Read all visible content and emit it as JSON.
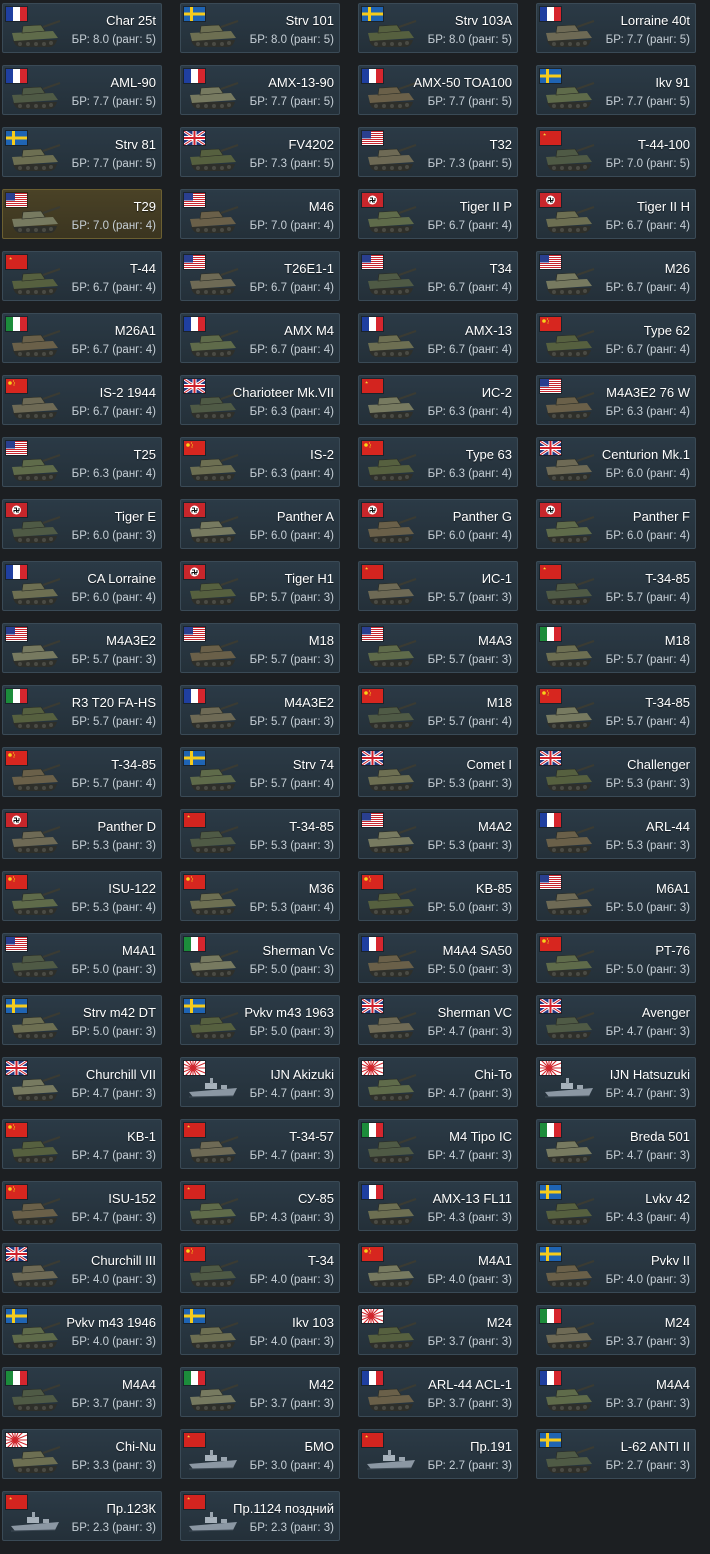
{
  "colors": {
    "background": "#1c1f22",
    "card": "#2b3a46",
    "card_selected": "#4a4226",
    "text": "#ffffff",
    "subtext": "#c6cfd6"
  },
  "vehicles": [
    {
      "name": "Char 25t",
      "br": "БР: 8.0 (ранг: 5)",
      "flag": "fr",
      "kind": "tank"
    },
    {
      "name": "Strv 101",
      "br": "БР: 8.0 (ранг: 5)",
      "flag": "se",
      "kind": "tank"
    },
    {
      "name": "Strv 103A",
      "br": "БР: 8.0 (ранг: 5)",
      "flag": "se",
      "kind": "tank"
    },
    {
      "name": "Lorraine 40t",
      "br": "БР: 7.7 (ранг: 5)",
      "flag": "fr",
      "kind": "tank"
    },
    {
      "name": "AML-90",
      "br": "БР: 7.7 (ранг: 5)",
      "flag": "fr",
      "kind": "tank"
    },
    {
      "name": "AMX-13-90",
      "br": "БР: 7.7 (ранг: 5)",
      "flag": "fr",
      "kind": "tank"
    },
    {
      "name": "AMX-50 TOA100",
      "br": "БР: 7.7 (ранг: 5)",
      "flag": "fr",
      "kind": "tank"
    },
    {
      "name": "Ikv 91",
      "br": "БР: 7.7 (ранг: 5)",
      "flag": "se",
      "kind": "tank"
    },
    {
      "name": "Strv 81",
      "br": "БР: 7.7 (ранг: 5)",
      "flag": "se",
      "kind": "tank"
    },
    {
      "name": "FV4202",
      "br": "БР: 7.3 (ранг: 5)",
      "flag": "uk",
      "kind": "tank"
    },
    {
      "name": "T32",
      "br": "БР: 7.3 (ранг: 5)",
      "flag": "us",
      "kind": "tank"
    },
    {
      "name": "T-44-100",
      "br": "БР: 7.0 (ранг: 5)",
      "flag": "ussr",
      "kind": "tank"
    },
    {
      "name": "T29",
      "br": "БР: 7.0 (ранг: 4)",
      "flag": "us",
      "kind": "tank",
      "selected": true
    },
    {
      "name": "M46",
      "br": "БР: 7.0 (ранг: 4)",
      "flag": "us",
      "kind": "tank"
    },
    {
      "name": "Tiger II P",
      "br": "БР: 6.7 (ранг: 4)",
      "flag": "de",
      "kind": "tank"
    },
    {
      "name": "Tiger II H",
      "br": "БР: 6.7 (ранг: 4)",
      "flag": "de",
      "kind": "tank"
    },
    {
      "name": "T-44",
      "br": "БР: 6.7 (ранг: 4)",
      "flag": "ussr",
      "kind": "tank"
    },
    {
      "name": "T26E1-1",
      "br": "БР: 6.7 (ранг: 4)",
      "flag": "us",
      "kind": "tank"
    },
    {
      "name": "T34",
      "br": "БР: 6.7 (ранг: 4)",
      "flag": "us",
      "kind": "tank"
    },
    {
      "name": "M26",
      "br": "БР: 6.7 (ранг: 4)",
      "flag": "us",
      "kind": "tank"
    },
    {
      "name": "M26A1",
      "br": "БР: 6.7 (ранг: 4)",
      "flag": "it",
      "kind": "tank"
    },
    {
      "name": "AMX M4",
      "br": "БР: 6.7 (ранг: 4)",
      "flag": "fr",
      "kind": "tank"
    },
    {
      "name": "AMX-13",
      "br": "БР: 6.7 (ранг: 4)",
      "flag": "fr",
      "kind": "tank"
    },
    {
      "name": "Type 62",
      "br": "БР: 6.7 (ранг: 4)",
      "flag": "cn",
      "kind": "tank"
    },
    {
      "name": "IS-2 1944",
      "br": "БР: 6.7 (ранг: 4)",
      "flag": "cn",
      "kind": "tank"
    },
    {
      "name": "Charioteer Mk.VII",
      "br": "БР: 6.3 (ранг: 4)",
      "flag": "uk",
      "kind": "tank"
    },
    {
      "name": "ИС-2",
      "br": "БР: 6.3 (ранг: 4)",
      "flag": "ussr",
      "kind": "tank"
    },
    {
      "name": "M4A3E2 76 W",
      "br": "БР: 6.3 (ранг: 4)",
      "flag": "us",
      "kind": "tank"
    },
    {
      "name": "T25",
      "br": "БР: 6.3 (ранг: 4)",
      "flag": "us",
      "kind": "tank"
    },
    {
      "name": "IS-2",
      "br": "БР: 6.3 (ранг: 4)",
      "flag": "cn",
      "kind": "tank"
    },
    {
      "name": "Type 63",
      "br": "БР: 6.3 (ранг: 4)",
      "flag": "cn",
      "kind": "tank"
    },
    {
      "name": "Centurion Mk.1",
      "br": "БР: 6.0 (ранг: 4)",
      "flag": "uk",
      "kind": "tank"
    },
    {
      "name": "Tiger E",
      "br": "БР: 6.0 (ранг: 3)",
      "flag": "de",
      "kind": "tank"
    },
    {
      "name": "Panther A",
      "br": "БР: 6.0 (ранг: 4)",
      "flag": "de",
      "kind": "tank"
    },
    {
      "name": "Panther G",
      "br": "БР: 6.0 (ранг: 4)",
      "flag": "de",
      "kind": "tank"
    },
    {
      "name": "Panther F",
      "br": "БР: 6.0 (ранг: 4)",
      "flag": "de",
      "kind": "tank"
    },
    {
      "name": "CA Lorraine",
      "br": "БР: 6.0 (ранг: 4)",
      "flag": "fr",
      "kind": "tank"
    },
    {
      "name": "Tiger H1",
      "br": "БР: 5.7 (ранг: 3)",
      "flag": "de",
      "kind": "tank"
    },
    {
      "name": "ИС-1",
      "br": "БР: 5.7 (ранг: 3)",
      "flag": "ussr",
      "kind": "tank"
    },
    {
      "name": "T-34-85",
      "br": "БР: 5.7 (ранг: 4)",
      "flag": "ussr",
      "kind": "tank"
    },
    {
      "name": "M4A3E2",
      "br": "БР: 5.7 (ранг: 3)",
      "flag": "us",
      "kind": "tank"
    },
    {
      "name": "M18",
      "br": "БР: 5.7 (ранг: 3)",
      "flag": "us",
      "kind": "tank"
    },
    {
      "name": "M4A3",
      "br": "БР: 5.7 (ранг: 3)",
      "flag": "us",
      "kind": "tank"
    },
    {
      "name": "M18",
      "br": "БР: 5.7 (ранг: 4)",
      "flag": "it",
      "kind": "tank"
    },
    {
      "name": "R3 T20 FA-HS",
      "br": "БР: 5.7 (ранг: 4)",
      "flag": "it",
      "kind": "tank"
    },
    {
      "name": "M4A3E2",
      "br": "БР: 5.7 (ранг: 3)",
      "flag": "fr",
      "kind": "tank"
    },
    {
      "name": "M18",
      "br": "БР: 5.7 (ранг: 4)",
      "flag": "cn",
      "kind": "tank"
    },
    {
      "name": "T-34-85",
      "br": "БР: 5.7 (ранг: 4)",
      "flag": "cn",
      "kind": "tank"
    },
    {
      "name": "T-34-85",
      "br": "БР: 5.7 (ранг: 4)",
      "flag": "cn",
      "kind": "tank"
    },
    {
      "name": "Strv 74",
      "br": "БР: 5.7 (ранг: 4)",
      "flag": "se",
      "kind": "tank"
    },
    {
      "name": "Comet I",
      "br": "БР: 5.3 (ранг: 3)",
      "flag": "uk",
      "kind": "tank"
    },
    {
      "name": "Challenger",
      "br": "БР: 5.3 (ранг: 3)",
      "flag": "uk",
      "kind": "tank"
    },
    {
      "name": "Panther D",
      "br": "БР: 5.3 (ранг: 3)",
      "flag": "de",
      "kind": "tank"
    },
    {
      "name": "T-34-85",
      "br": "БР: 5.3 (ранг: 3)",
      "flag": "ussr",
      "kind": "tank"
    },
    {
      "name": "M4A2",
      "br": "БР: 5.3 (ранг: 3)",
      "flag": "us",
      "kind": "tank"
    },
    {
      "name": "ARL-44",
      "br": "БР: 5.3 (ранг: 3)",
      "flag": "fr",
      "kind": "tank"
    },
    {
      "name": "ISU-122",
      "br": "БР: 5.3 (ранг: 4)",
      "flag": "cn",
      "kind": "tank"
    },
    {
      "name": "M36",
      "br": "БР: 5.3 (ранг: 4)",
      "flag": "cn",
      "kind": "tank"
    },
    {
      "name": "KB-85",
      "br": "БР: 5.0 (ранг: 3)",
      "flag": "cn",
      "kind": "tank"
    },
    {
      "name": "M6A1",
      "br": "БР: 5.0 (ранг: 3)",
      "flag": "us",
      "kind": "tank"
    },
    {
      "name": "M4A1",
      "br": "БР: 5.0 (ранг: 3)",
      "flag": "us",
      "kind": "tank"
    },
    {
      "name": "Sherman Vc",
      "br": "БР: 5.0 (ранг: 3)",
      "flag": "it",
      "kind": "tank"
    },
    {
      "name": "M4A4 SA50",
      "br": "БР: 5.0 (ранг: 3)",
      "flag": "fr",
      "kind": "tank"
    },
    {
      "name": "PT-76",
      "br": "БР: 5.0 (ранг: 3)",
      "flag": "cn",
      "kind": "tank"
    },
    {
      "name": "Strv m42 DT",
      "br": "БР: 5.0 (ранг: 3)",
      "flag": "se",
      "kind": "tank"
    },
    {
      "name": "Pvkv m43 1963",
      "br": "БР: 5.0 (ранг: 3)",
      "flag": "se",
      "kind": "tank"
    },
    {
      "name": "Sherman VC",
      "br": "БР: 4.7 (ранг: 3)",
      "flag": "uk",
      "kind": "tank"
    },
    {
      "name": "Avenger",
      "br": "БР: 4.7 (ранг: 3)",
      "flag": "uk",
      "kind": "tank"
    },
    {
      "name": "Churchill VII",
      "br": "БР: 4.7 (ранг: 3)",
      "flag": "uk",
      "kind": "tank"
    },
    {
      "name": "IJN Akizuki",
      "br": "БР: 4.7 (ранг: 3)",
      "flag": "jp",
      "kind": "ship"
    },
    {
      "name": "Chi-To",
      "br": "БР: 4.7 (ранг: 3)",
      "flag": "jp",
      "kind": "tank"
    },
    {
      "name": "IJN Hatsuzuki",
      "br": "БР: 4.7 (ранг: 3)",
      "flag": "jp",
      "kind": "ship"
    },
    {
      "name": "KB-1",
      "br": "БР: 4.7 (ранг: 3)",
      "flag": "cn",
      "kind": "tank"
    },
    {
      "name": "T-34-57",
      "br": "БР: 4.7 (ранг: 3)",
      "flag": "ussr",
      "kind": "tank"
    },
    {
      "name": "M4 Tipo IC",
      "br": "БР: 4.7 (ранг: 3)",
      "flag": "it",
      "kind": "tank"
    },
    {
      "name": "Breda 501",
      "br": "БР: 4.7 (ранг: 3)",
      "flag": "it",
      "kind": "tank"
    },
    {
      "name": "ISU-152",
      "br": "БР: 4.7 (ранг: 3)",
      "flag": "cn",
      "kind": "tank"
    },
    {
      "name": "СУ-85",
      "br": "БР: 4.3 (ранг: 3)",
      "flag": "ussr",
      "kind": "tank"
    },
    {
      "name": "AMX-13 FL11",
      "br": "БР: 4.3 (ранг: 3)",
      "flag": "fr",
      "kind": "tank"
    },
    {
      "name": "Lvkv 42",
      "br": "БР: 4.3 (ранг: 4)",
      "flag": "se",
      "kind": "tank"
    },
    {
      "name": "Churchill III",
      "br": "БР: 4.0 (ранг: 3)",
      "flag": "uk",
      "kind": "tank"
    },
    {
      "name": "T-34",
      "br": "БР: 4.0 (ранг: 3)",
      "flag": "cn",
      "kind": "tank"
    },
    {
      "name": "M4A1",
      "br": "БР: 4.0 (ранг: 3)",
      "flag": "cn",
      "kind": "tank"
    },
    {
      "name": "Pvkv II",
      "br": "БР: 4.0 (ранг: 3)",
      "flag": "se",
      "kind": "tank"
    },
    {
      "name": "Pvkv m43 1946",
      "br": "БР: 4.0 (ранг: 3)",
      "flag": "se",
      "kind": "tank"
    },
    {
      "name": "Ikv 103",
      "br": "БР: 4.0 (ранг: 3)",
      "flag": "se",
      "kind": "tank"
    },
    {
      "name": "M24",
      "br": "БР: 3.7 (ранг: 3)",
      "flag": "jp",
      "kind": "tank"
    },
    {
      "name": "M24",
      "br": "БР: 3.7 (ранг: 3)",
      "flag": "it",
      "kind": "tank"
    },
    {
      "name": "M4A4",
      "br": "БР: 3.7 (ранг: 3)",
      "flag": "it",
      "kind": "tank"
    },
    {
      "name": "M42",
      "br": "БР: 3.7 (ранг: 3)",
      "flag": "it",
      "kind": "tank"
    },
    {
      "name": "ARL-44 ACL-1",
      "br": "БР: 3.7 (ранг: 3)",
      "flag": "fr",
      "kind": "tank"
    },
    {
      "name": "M4A4",
      "br": "БР: 3.7 (ранг: 3)",
      "flag": "fr",
      "kind": "tank"
    },
    {
      "name": "Chi-Nu",
      "br": "БР: 3.3 (ранг: 3)",
      "flag": "jp",
      "kind": "tank"
    },
    {
      "name": "БМО",
      "br": "БР: 3.0 (ранг: 4)",
      "flag": "ussr",
      "kind": "ship"
    },
    {
      "name": "Пр.191",
      "br": "БР: 2.7 (ранг: 3)",
      "flag": "ussr",
      "kind": "ship"
    },
    {
      "name": "L-62 ANTI II",
      "br": "БР: 2.7 (ранг: 3)",
      "flag": "se",
      "kind": "tank"
    },
    {
      "name": "Пр.123К",
      "br": "БР: 2.3 (ранг: 3)",
      "flag": "ussr",
      "kind": "ship"
    },
    {
      "name": "Пр.1124 поздний",
      "br": "БР: 2.3 (ранг: 3)",
      "flag": "ussr",
      "kind": "ship"
    }
  ]
}
